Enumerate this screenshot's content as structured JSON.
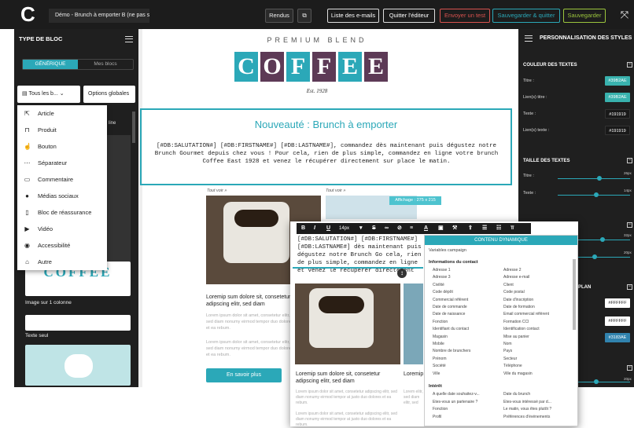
{
  "topbar": {
    "doc_title": "Démo - Brunch à emporter B (ne pas su",
    "rendus": "Rendus",
    "liste_emails": "Liste des e-mails",
    "quitter_editeur": "Quitter l'éditeur",
    "envoyer_test": "Envoyer un test",
    "sauvegarder_quitter": "Sauvegarder & quitter",
    "sauvegarder": "Sauvegarder"
  },
  "left": {
    "title": "TYPE DE BLOC",
    "tab_generique": "GÉNÉRIQUE",
    "tab_mes_blocs": "Mes blocs",
    "select_tous": "Tous les b...",
    "options_globales": "Options globales",
    "dropdown": [
      "Article",
      "Produit",
      "Bouton",
      "Séparateur",
      "Commentaire",
      "Médias sociaux",
      "Bloc de réassurance",
      "Vidéo",
      "Accessibilité",
      "Autre"
    ],
    "peek_text": "line",
    "thumb1_label": "Image sur 1 colonne",
    "thumb2_label": "Texte seul"
  },
  "canvas": {
    "premium": "PREMIUM BLEND",
    "logo_letters": [
      "C",
      "O",
      "F",
      "F",
      "E",
      "E"
    ],
    "est": "Est. 1928",
    "headline": "Nouveauté : Brunch à emporter",
    "body": "[#DB:SALUTATION#] [#DB:FIRSTNAME#] [#DB:LASTNAME#], commandez dès maintenant puis dégustez notre Brunch Gourmet depuis chez vous ! Pour cela, rien de plus simple, commandez en ligne votre brunch Coffee East 1928 et venez le récupérer directement sur place le matin.",
    "tout_voir": "Tout voir »",
    "affichage": "Affichage : 275 x 215",
    "lorem_title": "Loremip sum dolore sit, consetetur adipscing elitr, sed diam",
    "lorem_body": "Lorem ipsum dolor sit amet, consetetur elitr, sed diam nonumy eirmod tempor duo dolores et ea rebum.",
    "lorem_body2": "Lorem ipsum dolor sit amet, consetetur elitr, sed diam nonumy eirmod tempor duo dolores et ea rebum.",
    "en_savoir": "En savoir plus"
  },
  "right": {
    "title": "PERSONNALISATION DES STYLES",
    "couleur_textes": "COULEUR DES TEXTES",
    "titre": "Titre :",
    "liens_titre": "Lien(s) titre :",
    "texte": "Texte :",
    "liens_texte": "Lien(s) texte :",
    "chip_titre": "#39B2AE",
    "chip_liens_titre": "#39B2AE",
    "chip_texte": "#191919",
    "chip_liens_texte": "#191919",
    "taille_textes": "TAILLE DES TEXTES",
    "size_titre": "26px",
    "size_texte": "14px",
    "size_a": "32px",
    "size_b": "20px",
    "plan": "PLAN",
    "chip_ff1": "#FFFFFF",
    "chip_ff2": "#FFFFFF",
    "chip_accent": "#3183AE",
    "size_c": "20px",
    "accent": "#2ba8b8"
  },
  "zoom": {
    "font_size": "14px",
    "body": "[#DB:SALUTATION#] [#DB:FIRSTNAME#] [#DB:LASTNAME#] dès maintenant puis dégustez notre Brunch Go cela, rien de plus simple, commandez en ligne et venez le récupérer directement",
    "lorem_title": "Loremip sum dolore sit, consetetur adipscing elitr, sed diam",
    "lorem_title2": "Loremip elitr, sed",
    "lorem_body": "Lorem ipsum dolor sit amet, consetetur adipscing elitr, sed diam nonumy eirmod tempor at justo duo dolores et ea rebum.",
    "lorem_body2": "Lorem ipsum dolor sit amet, consetetur adipscing elitr, sed diam nonumy eirmod tempor at justo duo dolores et ea rebum.",
    "lorem_body3": "Lorem elitr, sed diam elitr, sed"
  },
  "dyn": {
    "head": "CONTENU DYNAMIQUE",
    "variables": "Variables campaign",
    "infos": "Informations du contact",
    "col1": [
      "Adresse 1",
      "Adresse 3",
      "Civilité",
      "Code dépôt",
      "Commercial référent",
      "Date de commande",
      "Date de naissance",
      "Fonction",
      "Identifiant du contact",
      "Magasin",
      "Mobile",
      "Nombre de brunchers",
      "Prénom",
      "Société",
      "Ville"
    ],
    "col2": [
      "Adresse 2",
      "Adresse e-mail",
      "Client",
      "Code postal",
      "Date d'inscription",
      "Date de formation",
      "Email commercial référent",
      "Formation CCI",
      "Identification contact",
      "Mise au panier",
      "Nom",
      "Pays",
      "Secteur",
      "Téléphone",
      "Ville du magasin"
    ],
    "interet": "Intérêt",
    "col3": [
      "A quelle date souhaitez-v...",
      "Etes-vous un partenaire ?",
      "Fonction",
      "Profil"
    ],
    "col4": [
      "Date du brunch",
      "Etes-vous intéressé par d...",
      "Le matin, vous êtes plutôt ?",
      "Préférences d'événements"
    ]
  }
}
